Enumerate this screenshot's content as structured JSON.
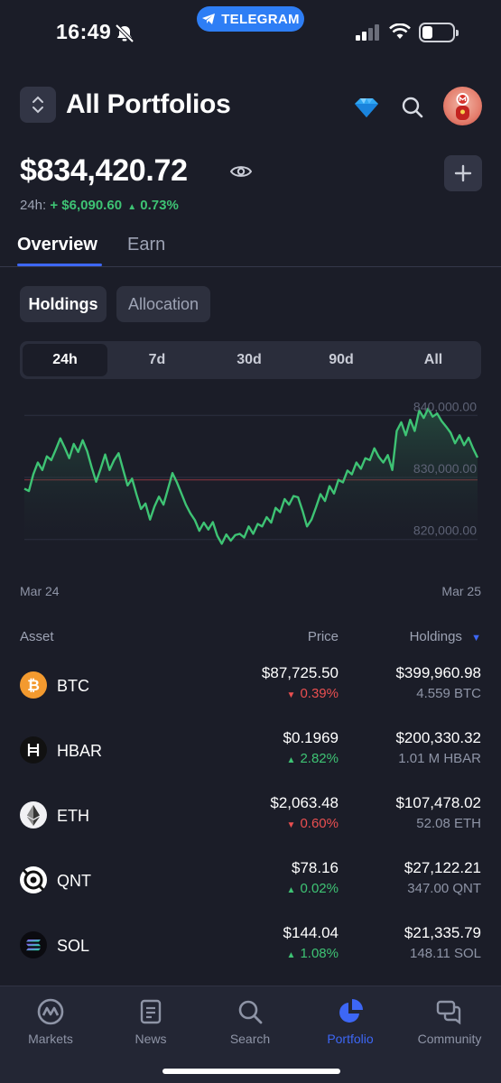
{
  "status": {
    "time": "16:49",
    "telegram_label": "TELEGRAM"
  },
  "header": {
    "title": "All Portfolios"
  },
  "balance": {
    "total": "$834,420.72",
    "change_label": "24h:",
    "change_amount": "+ $6,090.60",
    "change_percent": "0.73%"
  },
  "tabs": {
    "overview": "Overview",
    "earn": "Earn"
  },
  "views": {
    "holdings": "Holdings",
    "allocation": "Allocation"
  },
  "ranges": [
    "24h",
    "7d",
    "30d",
    "90d",
    "All"
  ],
  "selected_range": "24h",
  "chart_data": {
    "type": "area",
    "y_ticks": [
      "840,000.00",
      "830,000.00",
      "820,000.00"
    ],
    "ylim": [
      818500,
      841500
    ],
    "x_labels": [
      "Mar 24",
      "Mar 25"
    ],
    "values": [
      828200,
      827800,
      830500,
      832400,
      831200,
      833400,
      832800,
      834500,
      836300,
      834800,
      833100,
      835400,
      834100,
      836000,
      834200,
      831600,
      829300,
      831400,
      833700,
      831200,
      832800,
      833900,
      831300,
      828700,
      829800,
      827200,
      824900,
      825800,
      823200,
      825300,
      826900,
      825600,
      828100,
      830700,
      829200,
      827400,
      825600,
      824200,
      823100,
      821400,
      822700,
      821600,
      822800,
      820600,
      819300,
      820800,
      819800,
      820700,
      820900,
      820300,
      822100,
      820900,
      822500,
      822100,
      823600,
      822700,
      825100,
      824400,
      826500,
      825600,
      827000,
      826800,
      824600,
      822100,
      823200,
      825200,
      827300,
      826200,
      828600,
      827400,
      829600,
      829200,
      831100,
      830500,
      832400,
      831400,
      833100,
      832800,
      834700,
      833300,
      832400,
      833600,
      831200,
      837500,
      838900,
      836800,
      839300,
      837500,
      840800,
      839600,
      841100,
      839800,
      840300,
      839100,
      838200,
      837200,
      835500,
      836800,
      835200,
      836400,
      834700,
      833200
    ],
    "baseline": 829600,
    "line_color": "#3ec374",
    "reference_color": "#c0434a"
  },
  "table": {
    "col_asset": "Asset",
    "col_price": "Price",
    "col_holdings": "Holdings",
    "rows": [
      {
        "symbol": "BTC",
        "price": "$87,725.50",
        "change": "0.39%",
        "direction": "down",
        "value": "$399,960.98",
        "amount": "4.559 BTC",
        "icon": "bitcoin-icon",
        "icon_bg": "#f39a2f"
      },
      {
        "symbol": "HBAR",
        "price": "$0.1969",
        "change": "2.82%",
        "direction": "up",
        "value": "$200,330.32",
        "amount": "1.01 M HBAR",
        "icon": "hbar-icon",
        "icon_bg": "#111111"
      },
      {
        "symbol": "ETH",
        "price": "$2,063.48",
        "change": "0.60%",
        "direction": "down",
        "value": "$107,478.02",
        "amount": "52.08 ETH",
        "icon": "ethereum-icon",
        "icon_bg": "#f1f1f4"
      },
      {
        "symbol": "QNT",
        "price": "$78.16",
        "change": "0.02%",
        "direction": "up",
        "value": "$27,122.21",
        "amount": "347.00 QNT",
        "icon": "quant-icon",
        "icon_bg": "#ffffff"
      },
      {
        "symbol": "SOL",
        "price": "$144.04",
        "change": "1.08%",
        "direction": "up",
        "value": "$21,335.79",
        "amount": "148.11 SOL",
        "icon": "solana-icon",
        "icon_bg": "#0b0b10"
      }
    ]
  },
  "nav": {
    "markets": "Markets",
    "news": "News",
    "search": "Search",
    "portfolio": "Portfolio",
    "community": "Community",
    "active": "portfolio"
  },
  "colors": {
    "accent": "#3d67f5",
    "positive": "#3ec374",
    "negative": "#ea4f50",
    "background": "#1b1d28"
  }
}
